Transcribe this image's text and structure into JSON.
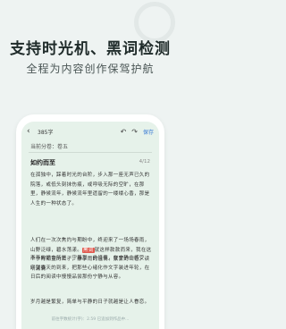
{
  "hero": {
    "title": "支持时光机、黑词检测",
    "subtitle": "全程为内容创作保驾护航"
  },
  "editor": {
    "word_count": "385字",
    "save_label": "保存",
    "category_label": "当前分卷：卷五",
    "doc_title": "如约而至",
    "doc_date": "4/12",
    "paragraphs": {
      "p1": "在孤独中，踩着时光的台阶，步入那一座无声已久的院落，或低头刻抹伤痕，或呼吸无际的空旷，在那里，静候流年，静候流年里遗留的一缕缕心香，那是人生的一种状态了。",
      "p2": "人们在一次次焦灼与期盼中，终迎来了一场场春雨，山野泛绿，碧水荡漾。",
      "p2_mark": "黑词",
      "p2_after": "就这样款款而来，我在这个宁胃期望的日子，静享雨的温情、蒙蒙的山色，读听清清",
      "p3": "渐渐的远去所是，守着那一份诗意，在宁静中感受、守望春天的到来，把那些心绪化作文字装进年轮，在日后的阅读中慢慢品尝那份宁静与从容。",
      "p4": "岁月越是繁复，简单与平静的日子就越是让人眷恋。"
    },
    "status_text": "前往字数统计(字)：2.59 已追加到作品中..."
  }
}
